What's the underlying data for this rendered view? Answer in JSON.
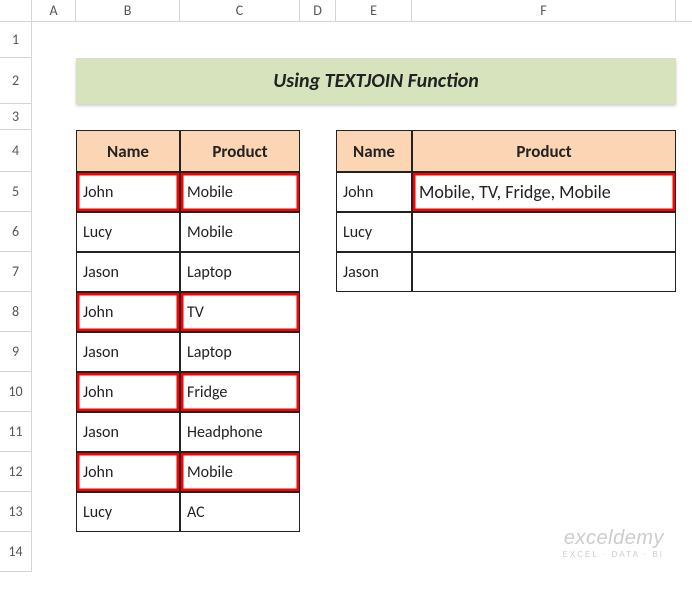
{
  "columns": {
    "A": "A",
    "B": "B",
    "C": "C",
    "D": "D",
    "E": "E",
    "F": "F"
  },
  "rows": {
    "r1": "1",
    "r2": "2",
    "r3": "3",
    "r4": "4",
    "r5": "5",
    "r6": "6",
    "r7": "7",
    "r8": "8",
    "r9": "9",
    "r10": "10",
    "r11": "11",
    "r12": "12",
    "r13": "13",
    "r14": "14"
  },
  "title": "Using TEXTJOIN Function",
  "left_table": {
    "headers": {
      "name": "Name",
      "product": "Product"
    },
    "rows": [
      {
        "name": "John",
        "product": "Mobile",
        "highlight": true
      },
      {
        "name": "Lucy",
        "product": "Mobile",
        "highlight": false
      },
      {
        "name": "Jason",
        "product": "Laptop",
        "highlight": false
      },
      {
        "name": "John",
        "product": "TV",
        "highlight": true
      },
      {
        "name": "Jason",
        "product": "Laptop",
        "highlight": false
      },
      {
        "name": "John",
        "product": "Fridge",
        "highlight": true
      },
      {
        "name": "Jason",
        "product": "Headphone",
        "highlight": false
      },
      {
        "name": "John",
        "product": "Mobile",
        "highlight": true
      },
      {
        "name": "Lucy",
        "product": "AC",
        "highlight": false
      }
    ]
  },
  "right_table": {
    "headers": {
      "name": "Name",
      "product": "Product"
    },
    "rows": [
      {
        "name": "John",
        "product": "Mobile, TV, Fridge, Mobile",
        "highlight_product": true
      },
      {
        "name": "Lucy",
        "product": "",
        "highlight_product": false
      },
      {
        "name": "Jason",
        "product": "",
        "highlight_product": false
      }
    ]
  },
  "watermark": {
    "line1": "exceldemy",
    "line2": "EXCEL · DATA · BI"
  }
}
